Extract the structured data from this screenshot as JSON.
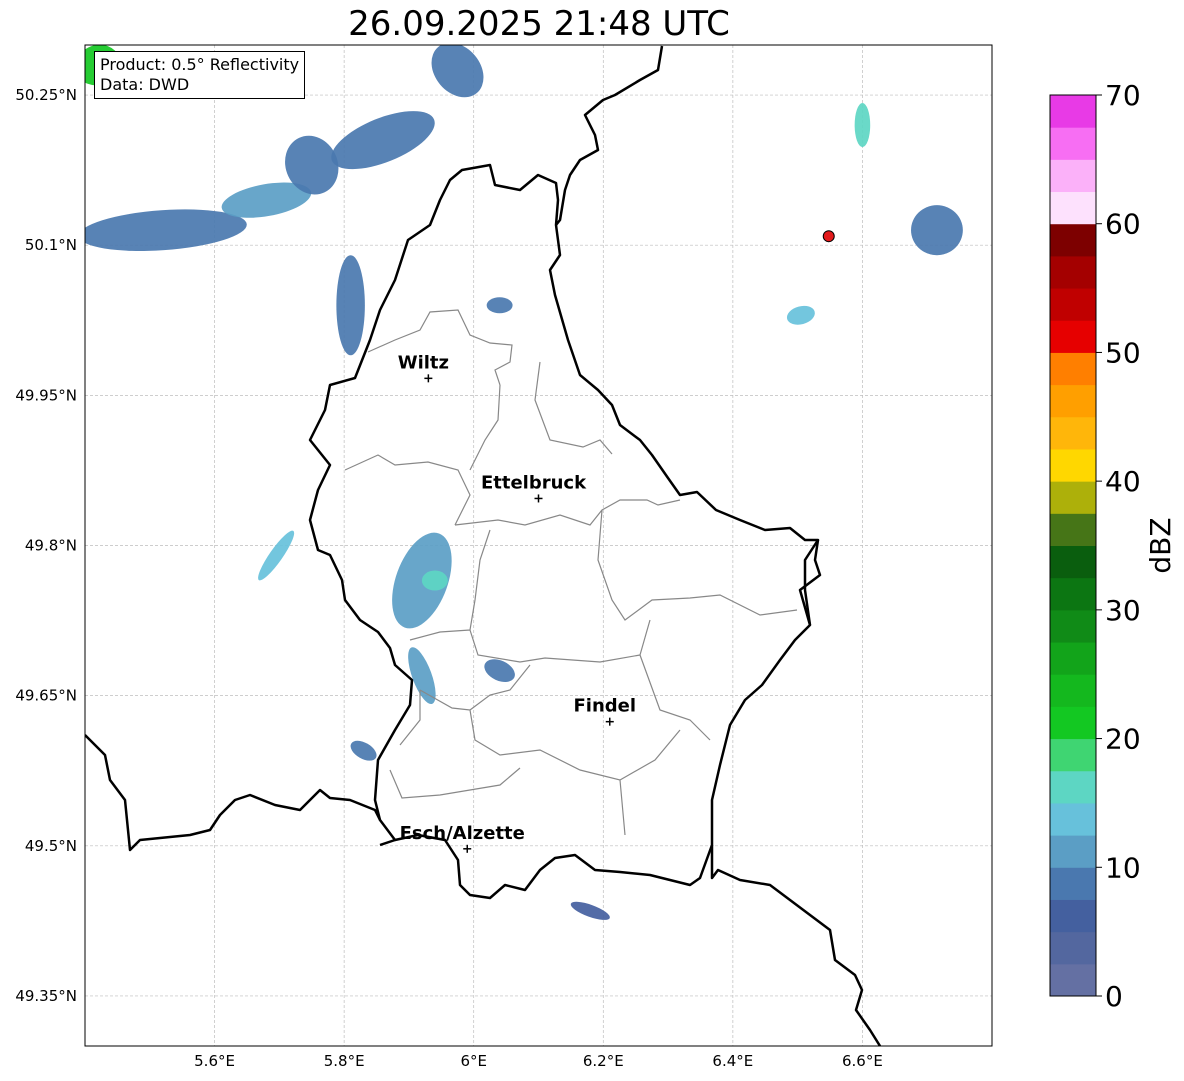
{
  "title": "26.09.2025 21:48 UTC",
  "info_box": {
    "product": "Product: 0.5° Reflectivity",
    "data": "Data: DWD"
  },
  "map": {
    "lon_range": [
      5.4,
      6.8
    ],
    "lat_range": [
      49.3,
      50.3
    ],
    "lon_ticks": [
      {
        "value": 5.6,
        "label": "5.6°E"
      },
      {
        "value": 5.8,
        "label": "5.8°E"
      },
      {
        "value": 6.0,
        "label": "6°E"
      },
      {
        "value": 6.2,
        "label": "6.2°E"
      },
      {
        "value": 6.4,
        "label": "6.4°E"
      },
      {
        "value": 6.6,
        "label": "6.6°E"
      }
    ],
    "lat_ticks": [
      {
        "value": 50.25,
        "label": "50.25°N"
      },
      {
        "value": 50.1,
        "label": "50.1°N"
      },
      {
        "value": 49.95,
        "label": "49.95°N"
      },
      {
        "value": 49.8,
        "label": "49.8°N"
      },
      {
        "value": 49.65,
        "label": "49.65°N"
      },
      {
        "value": 49.5,
        "label": "49.5°N"
      },
      {
        "value": 49.35,
        "label": "49.35°N"
      }
    ],
    "gridlines": true,
    "cities": [
      {
        "name": "Wiltz",
        "lon": 5.93,
        "lat": 49.967
      },
      {
        "name": "Ettelbruck",
        "lon": 6.1,
        "lat": 49.847
      },
      {
        "name": "Findel",
        "lon": 6.21,
        "lat": 49.624
      },
      {
        "name": "Esch/Alzette",
        "lon": 5.99,
        "lat": 49.497
      }
    ],
    "radar_site": {
      "lon": 6.548,
      "lat": 50.109,
      "color": "#e31a1c"
    }
  },
  "colorbar": {
    "label": "dBZ",
    "min": 0,
    "max": 70,
    "step": 2.5,
    "ticks": [
      "0",
      "10",
      "20",
      "30",
      "40",
      "50",
      "60",
      "70"
    ],
    "colors": [
      "#6470a3",
      "#53679f",
      "#44609f",
      "#4a78af",
      "#5b9ec5",
      "#67c1db",
      "#5dd6c3",
      "#3fd572",
      "#13c822",
      "#14b81e",
      "#12a41a",
      "#108b17",
      "#0c7612",
      "#0a5e0e",
      "#467517",
      "#adb00a",
      "#ffd700",
      "#ffb60a",
      "#ff9f00",
      "#ff7f00",
      "#e60000",
      "#c00000",
      "#a40000",
      "#7d0000",
      "#fde1fd",
      "#fbb1f9",
      "#f76ef3",
      "#e83ae6"
    ]
  },
  "echo_cells": [
    {
      "lon": 5.52,
      "lat": 50.115,
      "rlon": 0.13,
      "rlat": 0.02,
      "rot": -4,
      "dbz": 9
    },
    {
      "lon": 5.68,
      "lat": 50.145,
      "rlon": 0.07,
      "rlat": 0.016,
      "rot": -10,
      "dbz": 10
    },
    {
      "lon": 5.75,
      "lat": 50.18,
      "rlon": 0.04,
      "rlat": 0.03,
      "rot": -25,
      "dbz": 8
    },
    {
      "lon": 5.86,
      "lat": 50.205,
      "rlon": 0.085,
      "rlat": 0.022,
      "rot": -22,
      "dbz": 9
    },
    {
      "lon": 5.975,
      "lat": 50.275,
      "rlon": 0.035,
      "rlat": 0.03,
      "rot": -40,
      "dbz": 8
    },
    {
      "lon": 5.42,
      "lat": 50.28,
      "rlon": 0.035,
      "rlat": 0.02,
      "rot": -20,
      "dbz": 22
    },
    {
      "lon": 5.81,
      "lat": 50.04,
      "rlon": 0.022,
      "rlat": 0.05,
      "rot": 0,
      "dbz": 8
    },
    {
      "lon": 6.04,
      "lat": 50.04,
      "rlon": 0.02,
      "rlat": 0.008,
      "rot": 0,
      "dbz": 8
    },
    {
      "lon": 6.6,
      "lat": 50.22,
      "rlon": 0.012,
      "rlat": 0.022,
      "rot": 0,
      "dbz": 15
    },
    {
      "lon": 6.715,
      "lat": 50.115,
      "rlon": 0.04,
      "rlat": 0.025,
      "rot": 0,
      "dbz": 8
    },
    {
      "lon": 6.505,
      "lat": 50.03,
      "rlon": 0.022,
      "rlat": 0.009,
      "rot": -15,
      "dbz": 14
    },
    {
      "lon": 5.695,
      "lat": 49.79,
      "rlon": 0.01,
      "rlat": 0.03,
      "rot": 35,
      "dbz": 14
    },
    {
      "lon": 5.92,
      "lat": 49.765,
      "rlon": 0.04,
      "rlat": 0.05,
      "rot": 20,
      "dbz": 11
    },
    {
      "lon": 5.94,
      "lat": 49.765,
      "rlon": 0.02,
      "rlat": 0.01,
      "rot": 0,
      "dbz": 17
    },
    {
      "lon": 5.92,
      "lat": 49.67,
      "rlon": 0.015,
      "rlat": 0.03,
      "rot": -20,
      "dbz": 12
    },
    {
      "lon": 6.04,
      "lat": 49.675,
      "rlon": 0.025,
      "rlat": 0.01,
      "rot": 25,
      "dbz": 9
    },
    {
      "lon": 5.83,
      "lat": 49.595,
      "rlon": 0.022,
      "rlat": 0.008,
      "rot": 30,
      "dbz": 9
    },
    {
      "lon": 6.18,
      "lat": 49.435,
      "rlon": 0.032,
      "rlat": 0.006,
      "rot": 20,
      "dbz": 7
    }
  ]
}
